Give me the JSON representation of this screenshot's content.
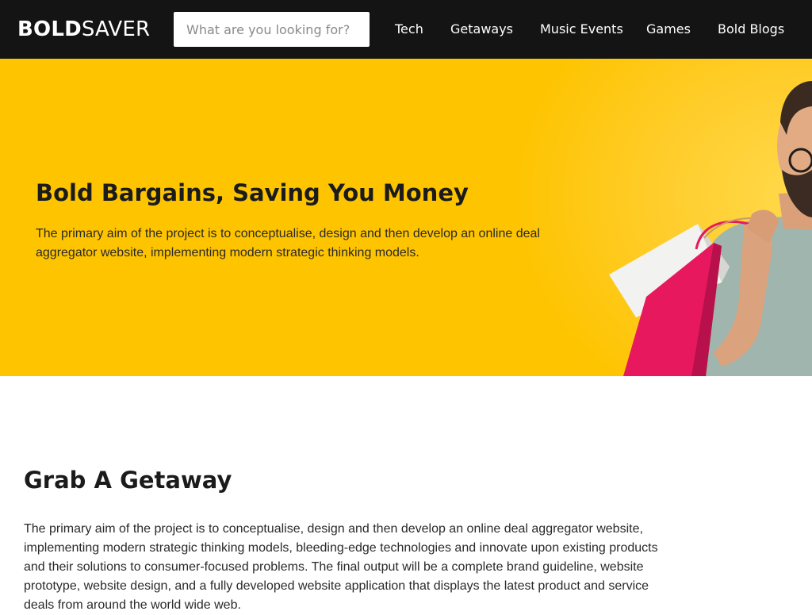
{
  "header": {
    "logo_bold": "BOLD",
    "logo_light": "SAVER",
    "search": {
      "placeholder": "What are you looking for?",
      "value": ""
    },
    "nav": [
      {
        "label": "Tech"
      },
      {
        "label": "Getaways"
      },
      {
        "label": "Music Events"
      },
      {
        "label": "Games"
      },
      {
        "label": "Bold Blogs"
      }
    ]
  },
  "hero": {
    "title": "Bold Bargains, Saving You Money",
    "text": "The primary aim of the project is to conceptualise, design and then develop an online deal aggregator website, implementing modern strategic thinking models.",
    "background_color": "#fec400"
  },
  "section": {
    "title": "Grab A Getaway",
    "text": "The primary aim of the project is to conceptualise, design and then develop an online deal aggregator website, implementing modern strategic thinking models, bleeding-edge technologies and innovate upon existing products and their solutions to consumer-focused problems. The final output will be a complete brand guideline, website prototype, website design, and a fully developed website application that displays the latest product and service deals from around the world wide web."
  },
  "colors": {
    "header_bg": "#141414",
    "accent": "#fec400",
    "text_dark": "#1b1b1b"
  }
}
